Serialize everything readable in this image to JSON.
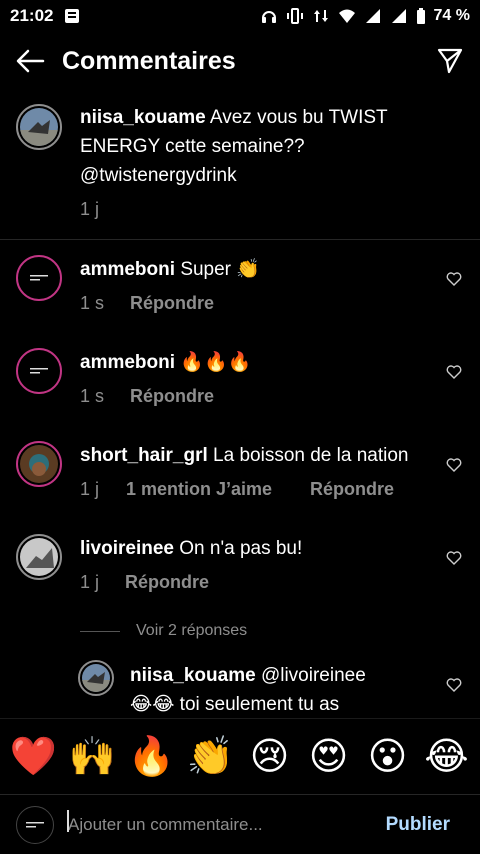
{
  "status_bar": {
    "time": "21:02",
    "battery": "74 %",
    "network": "3G"
  },
  "header": {
    "title": "Commentaires"
  },
  "caption": {
    "username": "niisa_kouame",
    "text_line1": "Avez vous bu TWIST",
    "text_line2": "ENERGY cette semaine??",
    "text_line3": "@twistenergydrink",
    "time": "1 j"
  },
  "comments": [
    {
      "username": "ammeboni",
      "text": "Super 👏",
      "time": "1 s",
      "reply": "Répondre"
    },
    {
      "username": "ammeboni",
      "text": "🔥🔥🔥",
      "time": "1 s",
      "reply": "Répondre"
    },
    {
      "username": "short_hair_grl",
      "text": "La boisson de la nation",
      "time": "1 j",
      "likes": "1 mention J’aime",
      "reply": "Répondre"
    },
    {
      "username": "livoireinee",
      "text": "On n'a pas bu!",
      "time": "1 j",
      "reply": "Répondre"
    }
  ],
  "view_replies": "Voir 2 réponses",
  "reply": {
    "username": "niisa_kouame",
    "text_line1": "@livoireinee",
    "text_line2": "😂😂 toi seulement tu as"
  },
  "emoji_bar": [
    "❤️",
    "🙌",
    "🔥",
    "👏",
    "😢",
    "😍",
    "😮",
    "😂"
  ],
  "input": {
    "placeholder": "Ajouter un commentaire...",
    "publish_label": "Publier"
  },
  "colors": {
    "accent": "#b3dbff",
    "muted": "#8e8e8e",
    "background": "#000000"
  }
}
